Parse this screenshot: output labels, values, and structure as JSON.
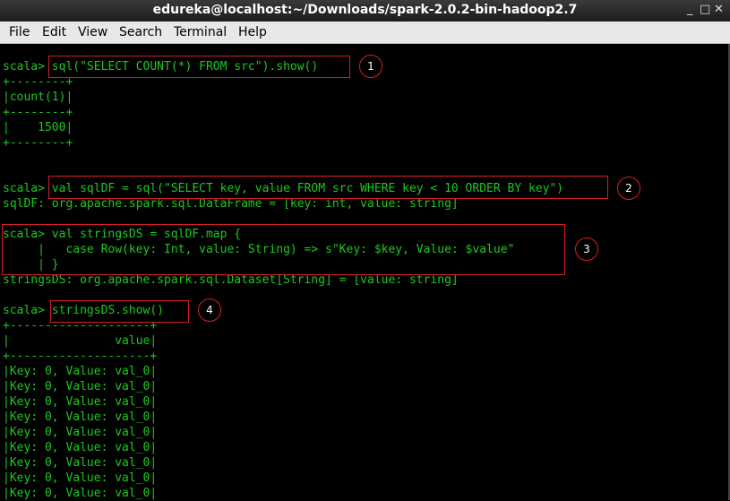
{
  "window": {
    "title": "edureka@localhost:~/Downloads/spark-2.0.2-bin-hadoop2.7",
    "minimize_glyph": "_",
    "maximize_glyph": "□",
    "close_glyph": "✕"
  },
  "menu": [
    "File",
    "Edit",
    "View",
    "Search",
    "Terminal",
    "Help"
  ],
  "terminal": {
    "lines": [
      "",
      "scala> sql(\"SELECT COUNT(*) FROM src\").show()",
      "+--------+",
      "|count(1)|",
      "+--------+",
      "|    1500|",
      "+--------+",
      "",
      "",
      "scala> val sqlDF = sql(\"SELECT key, value FROM src WHERE key < 10 ORDER BY key\")",
      "sqlDF: org.apache.spark.sql.DataFrame = [key: int, value: string]",
      "",
      "scala> val stringsDS = sqlDF.map {",
      "     |   case Row(key: Int, value: String) => s\"Key: $key, Value: $value\"",
      "     | }",
      "stringsDS: org.apache.spark.sql.Dataset[String] = [value: string]",
      "",
      "scala> stringsDS.show()",
      "+--------------------+",
      "|               value|",
      "+--------------------+",
      "|Key: 0, Value: val_0|",
      "|Key: 0, Value: val_0|",
      "|Key: 0, Value: val_0|",
      "|Key: 0, Value: val_0|",
      "|Key: 0, Value: val_0|",
      "|Key: 0, Value: val_0|",
      "|Key: 0, Value: val_0|",
      "|Key: 0, Value: val_0|",
      "|Key: 0, Value: val_0|"
    ]
  },
  "annotations": [
    "1",
    "2",
    "3",
    "4"
  ],
  "colors": {
    "terminal_text": "#1ec81e",
    "terminal_bg": "#000000",
    "annotation_red": "#d42020"
  }
}
